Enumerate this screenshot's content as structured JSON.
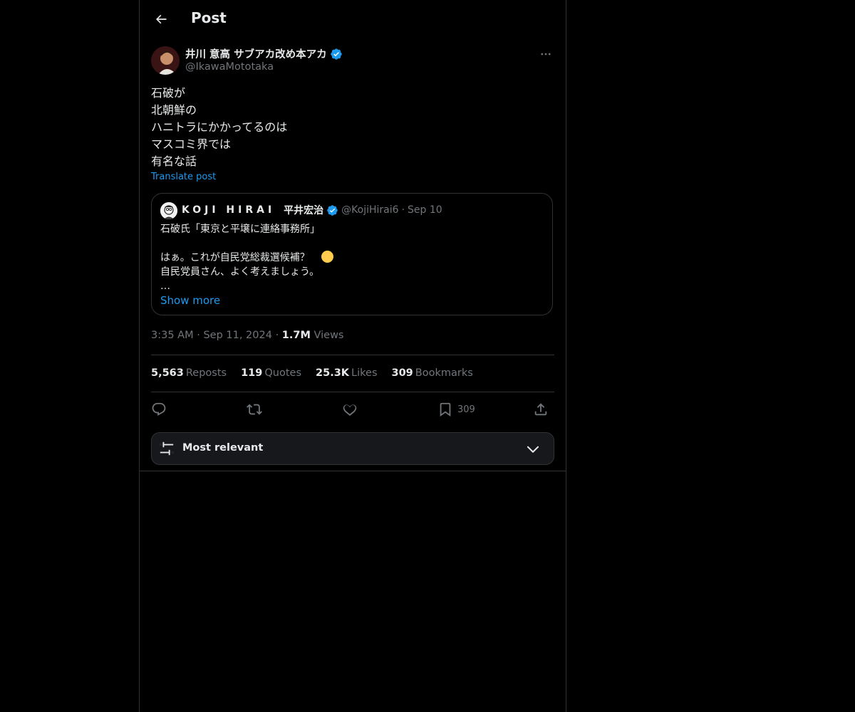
{
  "header": {
    "title": "Post",
    "back_icon": "arrow-left-icon"
  },
  "post": {
    "author": {
      "name": "井川 意高 サブアカ改め本アカ",
      "handle": "@IkawaMototaka",
      "verified": true
    },
    "lines": [
      "石破が",
      "北朝鮮の",
      "ハニトラにかかってるのは",
      "マスコミ界では",
      "有名な話"
    ],
    "translate_label": "Translate post",
    "quote": {
      "name_spaced": "KOJI HIRAI",
      "name": "平井宏治",
      "verified": true,
      "handle": "@KojiHirai6",
      "separator": "·",
      "date": "Sep 10",
      "lines": [
        "石破氏「東京と平壌に連絡事務所」",
        "",
        "はぁ。これが自民党総裁選候補？",
        "自民党員さん、よく考えましょう。",
        "…"
      ],
      "show_more": "Show more"
    },
    "time": "3:35 AM",
    "dot": "·",
    "date": "Sep 11, 2024",
    "views_count": "1.7M",
    "views_label": "Views",
    "stats": [
      {
        "count": "5,563",
        "label": "Reposts"
      },
      {
        "count": "119",
        "label": "Quotes"
      },
      {
        "count": "25.3K",
        "label": "Likes"
      },
      {
        "count": "309",
        "label": "Bookmarks"
      }
    ],
    "actions": {
      "bookmark_count": "309"
    }
  },
  "sort": {
    "label": "Most relevant"
  },
  "colors": {
    "background": "#000000",
    "text": "#e7e9ea",
    "muted": "#71767b",
    "accent": "#1d9bf0",
    "border": "#2f3336"
  }
}
